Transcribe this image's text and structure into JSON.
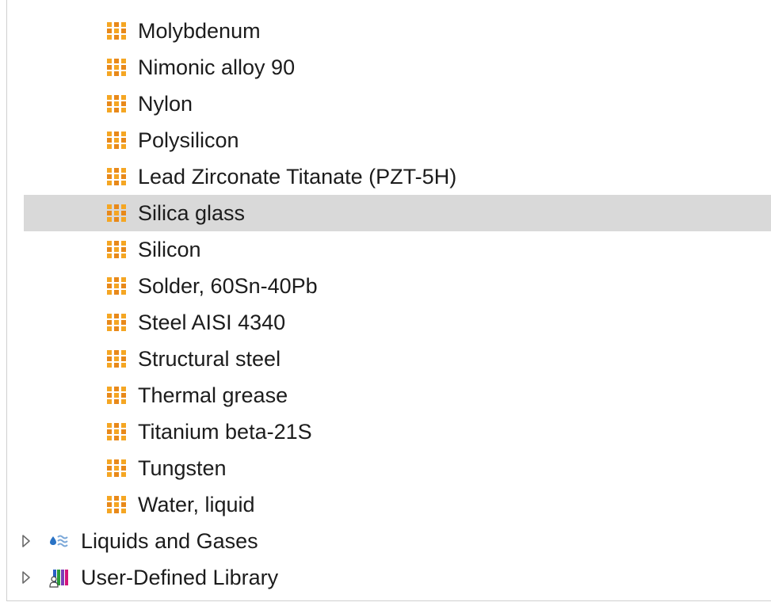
{
  "tree": {
    "materials": [
      {
        "label": "Molybdenum",
        "icon": "material-block-icon"
      },
      {
        "label": "Nimonic alloy 90",
        "icon": "material-block-icon"
      },
      {
        "label": "Nylon",
        "icon": "material-block-icon"
      },
      {
        "label": "Polysilicon",
        "icon": "material-block-icon"
      },
      {
        "label": "Lead Zirconate Titanate (PZT-5H)",
        "icon": "material-block-icon"
      },
      {
        "label": "Silica glass",
        "icon": "material-block-icon",
        "selected": true
      },
      {
        "label": "Silicon",
        "icon": "material-block-icon"
      },
      {
        "label": "Solder, 60Sn-40Pb",
        "icon": "material-block-icon"
      },
      {
        "label": "Steel AISI 4340",
        "icon": "material-block-icon"
      },
      {
        "label": "Structural steel",
        "icon": "material-block-icon"
      },
      {
        "label": "Thermal grease",
        "icon": "material-block-icon"
      },
      {
        "label": "Titanium beta-21S",
        "icon": "material-block-icon"
      },
      {
        "label": "Tungsten",
        "icon": "material-block-icon"
      },
      {
        "label": "Water, liquid",
        "icon": "material-block-icon"
      }
    ],
    "folders": [
      {
        "label": "Liquids and Gases",
        "icon": "liquids-gases-icon",
        "expanded": false
      },
      {
        "label": "User-Defined Library",
        "icon": "user-library-icon",
        "expanded": false
      }
    ]
  },
  "colors": {
    "material_icon": "#f5a623",
    "material_icon_dark": "#e8891a",
    "selection": "#d9d9d9",
    "liquid_blue": "#2a73c5",
    "library_magenta": "#d4147a",
    "library_green": "#2c9c3a",
    "library_blue": "#2a5fc5"
  }
}
